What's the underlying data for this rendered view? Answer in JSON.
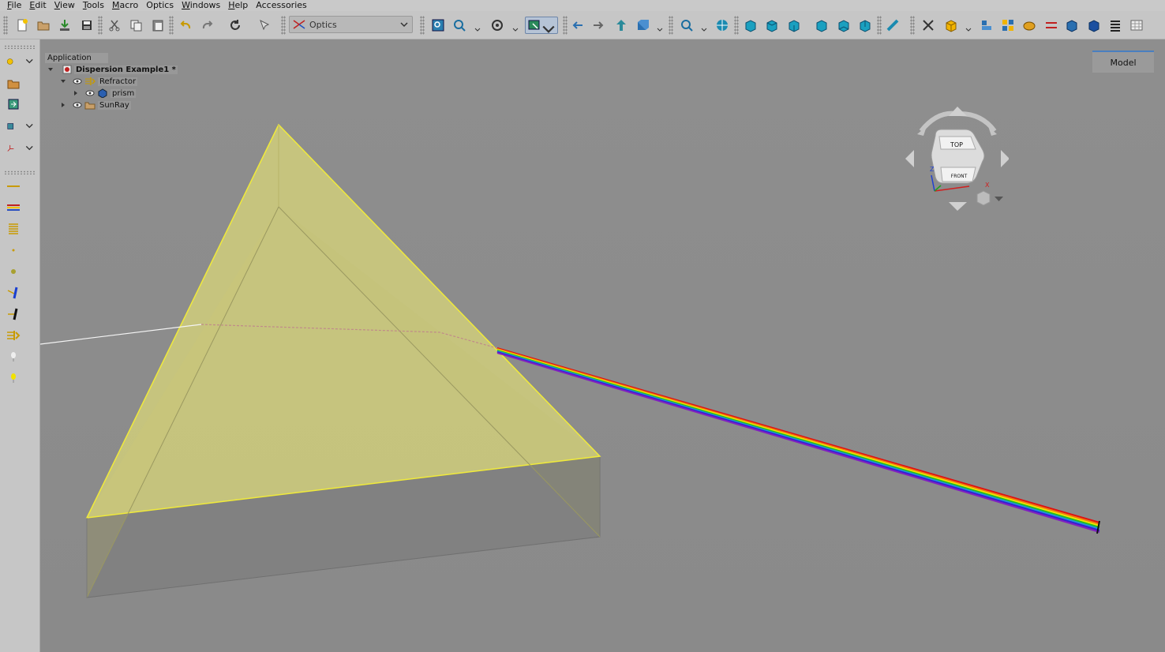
{
  "menu": {
    "items": [
      {
        "key": "F",
        "rest": "ile"
      },
      {
        "key": "E",
        "rest": "dit"
      },
      {
        "key": "V",
        "rest": "iew"
      },
      {
        "key": "T",
        "rest": "ools"
      },
      {
        "key": "M",
        "rest": "acro"
      },
      {
        "key": "",
        "rest": "Optics"
      },
      {
        "key": "W",
        "rest": "indows"
      },
      {
        "key": "H",
        "rest": "elp"
      },
      {
        "key": "",
        "rest": "Accessories"
      }
    ]
  },
  "workbench": {
    "selected": "Optics"
  },
  "tree": {
    "header": "Application",
    "document": "Dispersion Example1 *",
    "items": [
      {
        "label": "Refractor"
      },
      {
        "label": "prism"
      },
      {
        "label": "SunRay"
      }
    ]
  },
  "model_tab": {
    "label": "Model"
  },
  "navcube": {
    "top_face": "TOP",
    "front_face": "FRONT",
    "axis_x": "X",
    "axis_z": "Z"
  },
  "colors": {
    "prism_fill": "#d6d37a",
    "prism_edge": "#f0ea3a",
    "viewport_bg": "#8d8d8d",
    "toolbar_bg": "#c6c6c6",
    "accent": "#4a7fc0"
  }
}
